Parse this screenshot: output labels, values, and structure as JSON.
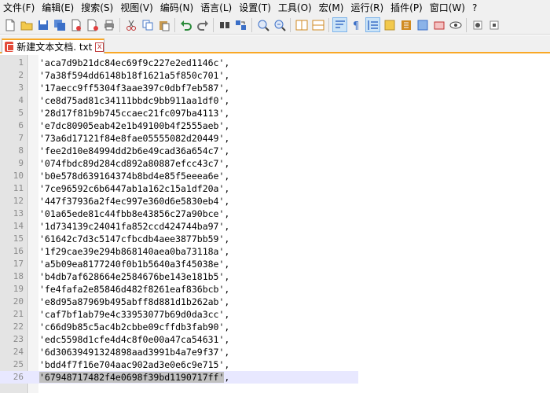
{
  "menu": [
    "文件(F)",
    "编辑(E)",
    "搜索(S)",
    "视图(V)",
    "编码(N)",
    "语言(L)",
    "设置(T)",
    "工具(O)",
    "宏(M)",
    "运行(R)",
    "插件(P)",
    "窗口(W)",
    "?"
  ],
  "toolbar_icons": [
    "new-file-icon",
    "open-file-icon",
    "save-icon",
    "save-all-icon",
    "close-icon",
    "close-all-icon",
    "print-icon",
    "cut-icon",
    "copy-icon",
    "paste-icon",
    "undo-icon",
    "redo-icon",
    "find-icon",
    "replace-icon",
    "zoom-in-icon",
    "zoom-out-icon",
    "sync-vertical-icon",
    "sync-horizontal-icon",
    "word-wrap-icon",
    "show-all-chars-icon",
    "indent-guide-icon",
    "doc-map-icon",
    "function-list-icon",
    "folder-workspace-icon",
    "monitoring-icon",
    "record-macro-icon",
    "stop-record-icon"
  ],
  "tab": {
    "title": "新建文本文档. txt",
    "close": "x"
  },
  "editor": {
    "current_line": 26,
    "lines": [
      "'aca7d9b21dc84ec69f9c227e2ed1146c',",
      "'7a38f594dd6148b18f1621a5f850c701',",
      "'17aecc9ff5304f3aae397c0dbf7eb587',",
      "'ce8d75ad81c34111bbdc9bb911aa1df0',",
      "'28d17f81b9b745ccaec21fc097ba4113',",
      "'e7dc80905eab42e1b49100b4f2555aeb',",
      "'73a6d17121f84e8fae05555082d20449',",
      "'fee2d10e84994dd2b6e49cad36a654c7',",
      "'074fbdc89d284cd892a80887efcc43c7',",
      "'b0e578d639164374b8bd4e85f5eeea6e',",
      "'7ce96592c6b6447ab1a162c15a1df20a',",
      "'447f37936a2f4ec997e360d6e5830eb4',",
      "'01a65ede81c44fbb8e43856c27a90bce',",
      "'1d734139c24041fa852ccd424744ba97',",
      "'61642c7d3c5147cfbcdb4aee3877bb59',",
      "'1f29cae39e294b868140aea0ba73118a',",
      "'a5b09ea8177240f0b1b5640a3f45038e',",
      "'b4db7af628664e2584676be143e181b5',",
      "'fe4fafa2e85846d482f8261eaf836bcb',",
      "'e8d95a87969b495abff8d881d1b262ab',",
      "'caf7bf1ab79e4c33953077b69d0da3cc',",
      "'c66d9b85c5ac4b2cbbe09cffdb3fab90',",
      "'edc5598d1cfe4d4c8f0e00a47ca54631',",
      "'6d30639491324898aad3991b4a7e9f37',",
      "'bdd4f7f16e704aac902ad3e0e6c9e715',"
    ],
    "last_line_selected": "'67948717482f4e0698f39bd1190717ff'",
    "last_line_rest": ","
  },
  "colors": {
    "tab_accent": "#f9a826",
    "current_line": "#e8e8ff",
    "selection": "#c0c0c0",
    "gutter": "#e4e4e4"
  }
}
